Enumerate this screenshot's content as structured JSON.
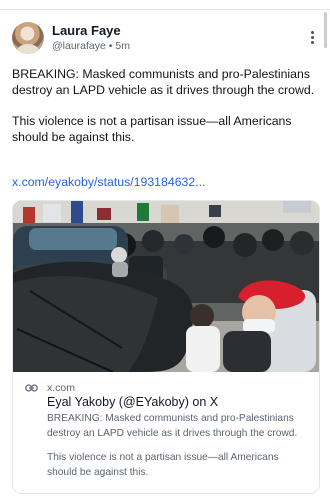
{
  "post": {
    "author_name": "Laura Faye",
    "handle": "@laurafaye",
    "separator": "•",
    "time": "5m",
    "paragraphs": [
      "BREAKING: Masked communists and pro-Palestinians destroy an LAPD vehicle as it drives through the crowd.",
      "This violence is not a partisan issue—all Americans should be against this."
    ],
    "link_text": "x.com/eyakoby/status/193184632..."
  },
  "card": {
    "domain": "x.com",
    "title": "Eyal Yakoby (@EYakoby) on X",
    "description": [
      "BREAKING: Masked communists and pro-Palestinians destroy an LAPD vehicle as it drives through the crowd.",
      "This violence is not a partisan issue—all Americans should be against this."
    ]
  },
  "icons": {
    "more": "more-vertical-icon",
    "link": "link-icon"
  },
  "colors": {
    "link": "#2563eb",
    "muted": "#5b6470",
    "text": "#0f1419",
    "border": "#e5e7eb"
  }
}
